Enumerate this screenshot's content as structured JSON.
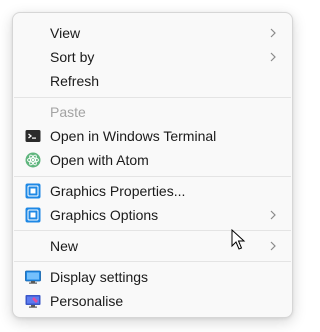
{
  "menu": {
    "items": [
      {
        "label": "View",
        "submenu": true
      },
      {
        "label": "Sort by",
        "submenu": true
      },
      {
        "label": "Refresh"
      },
      {
        "label": "Paste",
        "disabled": true
      },
      {
        "label": "Open in Windows Terminal",
        "icon": "terminal-icon"
      },
      {
        "label": "Open with Atom",
        "icon": "atom-icon"
      },
      {
        "label": "Graphics Properties...",
        "icon": "intel-graphics-icon"
      },
      {
        "label": "Graphics Options",
        "icon": "intel-graphics-icon",
        "submenu": true
      },
      {
        "label": "New",
        "submenu": true
      },
      {
        "label": "Display settings",
        "icon": "monitor-icon"
      },
      {
        "label": "Personalise",
        "icon": "personalise-icon"
      }
    ]
  },
  "colors": {
    "menu_background": "#f9f9f9",
    "text": "#1a1a1a",
    "disabled_text": "#a3a3a3",
    "chevron": "#8a8a8a",
    "atom_green": "#5fb57d",
    "intel_blue": "#1e88e5"
  }
}
